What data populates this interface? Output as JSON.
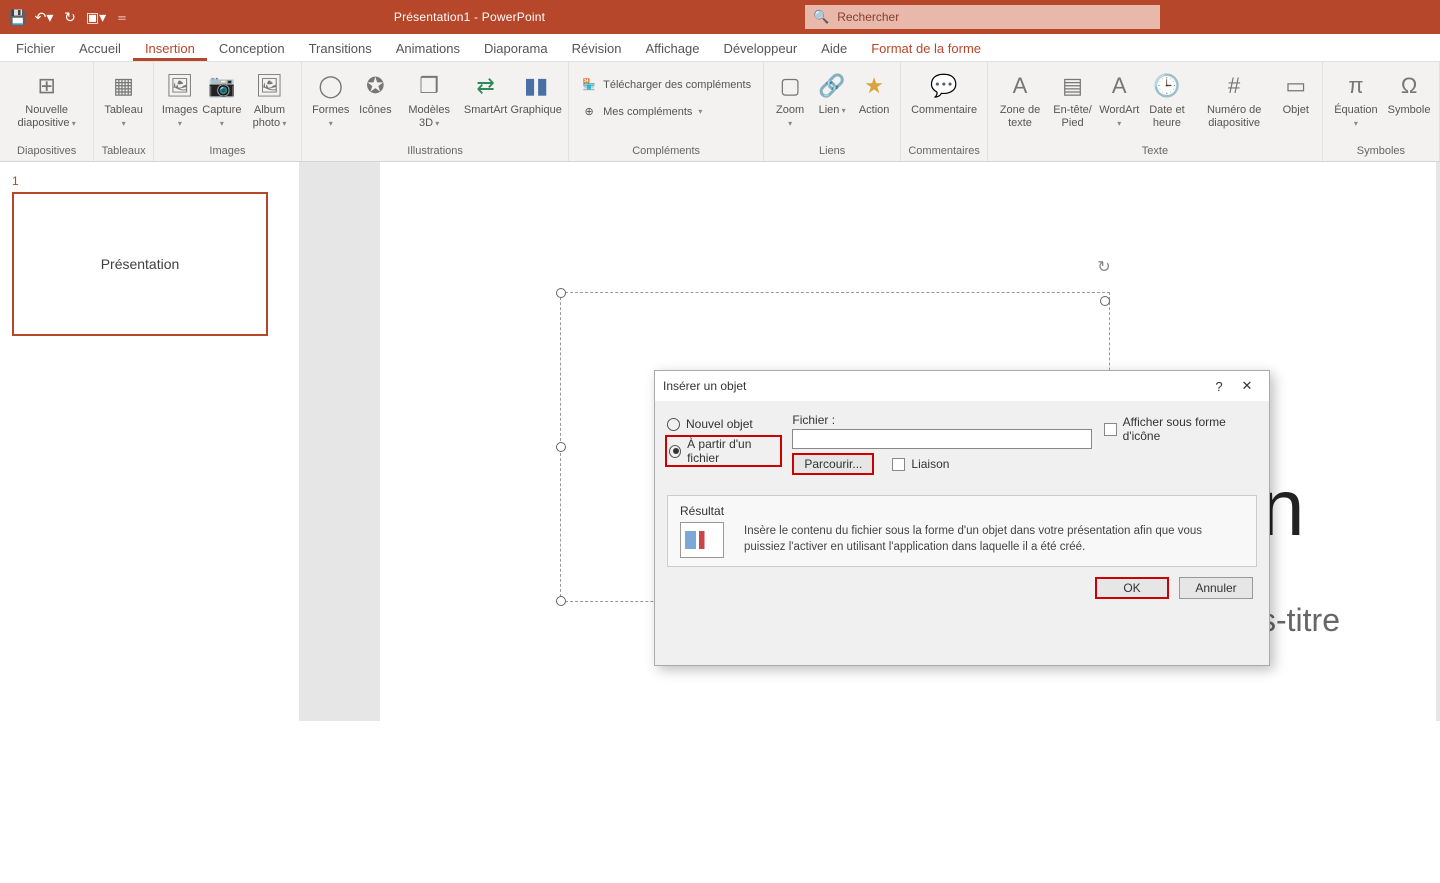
{
  "titlebar": {
    "title": "Présentation1 - PowerPoint",
    "search_placeholder": "Rechercher"
  },
  "tabs": {
    "fichier": "Fichier",
    "accueil": "Accueil",
    "insertion": "Insertion",
    "conception": "Conception",
    "transitions": "Transitions",
    "animations": "Animations",
    "diaporama": "Diaporama",
    "revision": "Révision",
    "affichage": "Affichage",
    "developpeur": "Développeur",
    "aide": "Aide",
    "format_forme": "Format de la forme"
  },
  "ribbon": {
    "groups": {
      "diapositives": "Diapositives",
      "tableaux": "Tableaux",
      "images": "Images",
      "illustrations": "Illustrations",
      "complements": "Compléments",
      "liens": "Liens",
      "commentaires": "Commentaires",
      "texte": "Texte",
      "symboles": "Symboles"
    },
    "buttons": {
      "nouvelle_diapo": "Nouvelle diapositive",
      "tableau": "Tableau",
      "images_btn": "Images",
      "capture": "Capture",
      "album_photo": "Album photo",
      "formes": "Formes",
      "icones": "Icônes",
      "modeles_3d": "Modèles 3D",
      "smartart": "SmartArt",
      "graphique": "Graphique",
      "telecharger_comp": "Télécharger des compléments",
      "mes_comp": "Mes compléments",
      "zoom": "Zoom",
      "lien": "Lien",
      "action": "Action",
      "commentaire": "Commentaire",
      "zone_texte": "Zone de texte",
      "entete_pied": "En-tête/ Pied",
      "wordart": "WordArt",
      "date_heure": "Date et heure",
      "numero_diapo": "Numéro de diapositive",
      "objet": "Objet",
      "equation": "Équation",
      "symbole": "Symbole"
    }
  },
  "thumb": {
    "number": "1",
    "label": "Présentation"
  },
  "slide": {
    "title_visible": "n",
    "subtitle_visible": "s-titre"
  },
  "dialog": {
    "title": "Insérer un objet",
    "radio_nouvel": "Nouvel objet",
    "radio_fichier": "À partir d'un fichier",
    "fichier_label": "Fichier :",
    "parcourir": "Parcourir...",
    "liaison": "Liaison",
    "afficher_icone": "Afficher sous forme d'icône",
    "resultat_label": "Résultat",
    "resultat_desc": "Insère le contenu du fichier sous la forme d'un objet dans votre présentation afin que vous puissiez l'activer en utilisant l'application dans laquelle il a été créé.",
    "ok": "OK",
    "annuler": "Annuler"
  }
}
